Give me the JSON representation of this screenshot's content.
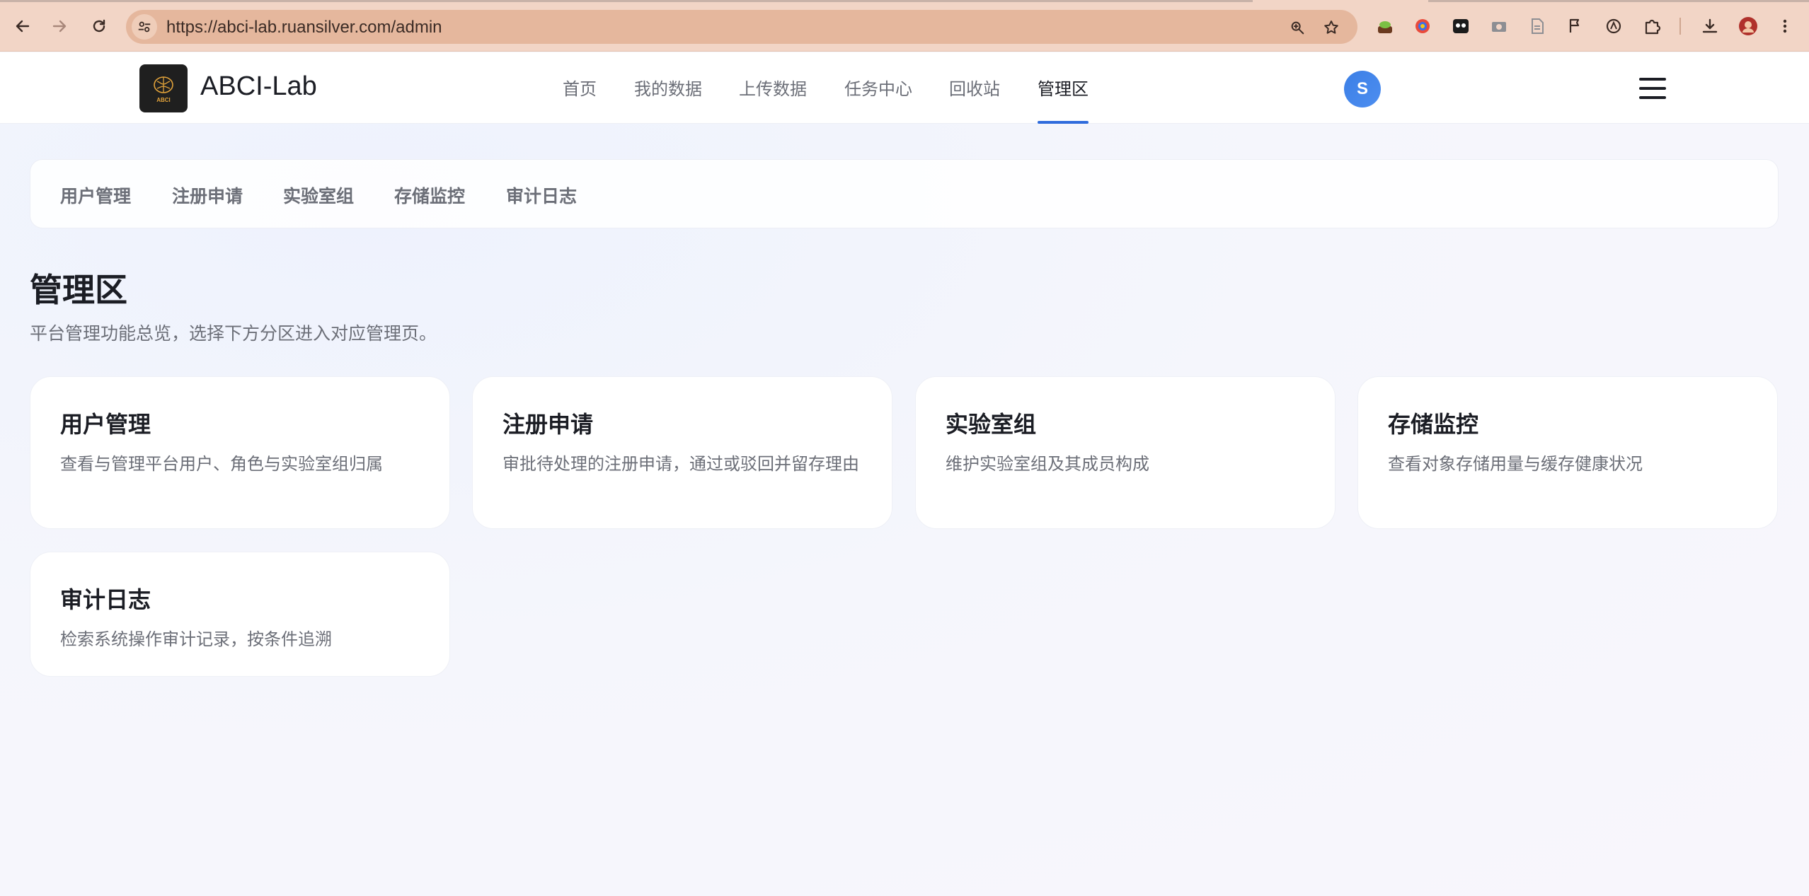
{
  "browser": {
    "url": "https://abci-lab.ruansilver.com/admin",
    "toolbar_color": "#f2d5c6",
    "url_bar_color": "#e5b79d"
  },
  "app": {
    "brand": "ABCI-Lab",
    "logo_text": "ABCI",
    "nav": [
      {
        "label": "首页"
      },
      {
        "label": "我的数据"
      },
      {
        "label": "上传数据"
      },
      {
        "label": "任务中心"
      },
      {
        "label": "回收站"
      },
      {
        "label": "管理区",
        "active": true
      }
    ],
    "avatar_initial": "S",
    "accent_color": "#2f6bdc"
  },
  "subnav": {
    "items": [
      {
        "label": "用户管理"
      },
      {
        "label": "注册申请"
      },
      {
        "label": "实验室组"
      },
      {
        "label": "存储监控"
      },
      {
        "label": "审计日志"
      }
    ]
  },
  "page": {
    "title": "管理区",
    "description": "平台管理功能总览，选择下方分区进入对应管理页。"
  },
  "cards": [
    {
      "title": "用户管理",
      "description": "查看与管理平台用户、角色与实验室组归属"
    },
    {
      "title": "注册申请",
      "description": "审批待处理的注册申请，通过或驳回并留存理由"
    },
    {
      "title": "实验室组",
      "description": "维护实验室组及其成员构成"
    },
    {
      "title": "存储监控",
      "description": "查看对象存储用量与缓存健康状况"
    },
    {
      "title": "审计日志",
      "description": "检索系统操作审计记录，按条件追溯"
    }
  ]
}
